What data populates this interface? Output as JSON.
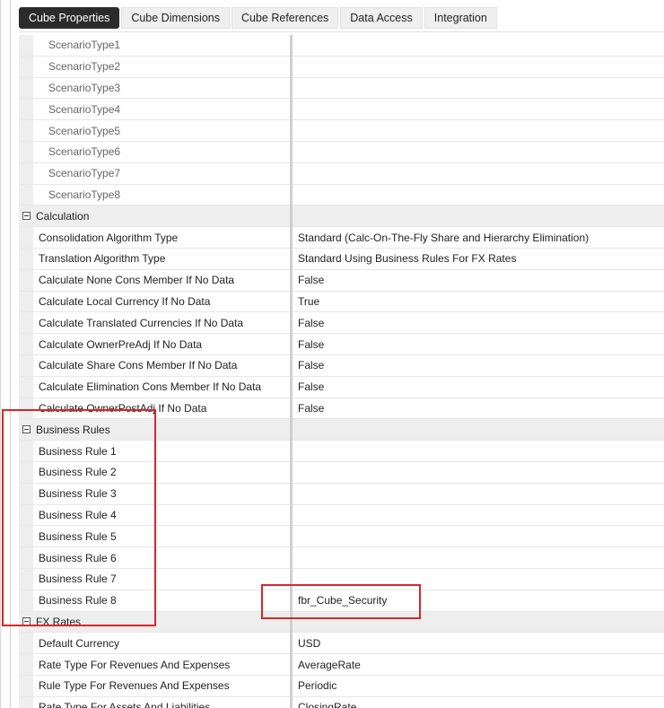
{
  "tabs": [
    {
      "label": "Cube Properties",
      "active": true
    },
    {
      "label": "Cube Dimensions",
      "active": false
    },
    {
      "label": "Cube References",
      "active": false
    },
    {
      "label": "Data Access",
      "active": false
    },
    {
      "label": "Integration",
      "active": false
    }
  ],
  "rows": [
    {
      "type": "item",
      "sub": true,
      "name": "ScenarioType1",
      "value": ""
    },
    {
      "type": "item",
      "sub": true,
      "name": "ScenarioType2",
      "value": ""
    },
    {
      "type": "item",
      "sub": true,
      "name": "ScenarioType3",
      "value": ""
    },
    {
      "type": "item",
      "sub": true,
      "name": "ScenarioType4",
      "value": ""
    },
    {
      "type": "item",
      "sub": true,
      "name": "ScenarioType5",
      "value": ""
    },
    {
      "type": "item",
      "sub": true,
      "name": "ScenarioType6",
      "value": ""
    },
    {
      "type": "item",
      "sub": true,
      "name": "ScenarioType7",
      "value": ""
    },
    {
      "type": "item",
      "sub": true,
      "name": "ScenarioType8",
      "value": ""
    },
    {
      "type": "category",
      "name": "Calculation"
    },
    {
      "type": "item",
      "name": "Consolidation Algorithm Type",
      "value": "Standard (Calc-On-The-Fly Share and Hierarchy Elimination)"
    },
    {
      "type": "item",
      "name": "Translation Algorithm Type",
      "value": "Standard Using Business Rules For FX Rates"
    },
    {
      "type": "item",
      "name": "Calculate None Cons Member If No Data",
      "value": "False"
    },
    {
      "type": "item",
      "name": "Calculate Local Currency If No Data",
      "value": "True"
    },
    {
      "type": "item",
      "name": "Calculate Translated Currencies If No Data",
      "value": "False"
    },
    {
      "type": "item",
      "name": "Calculate OwnerPreAdj If No Data",
      "value": "False"
    },
    {
      "type": "item",
      "name": "Calculate Share Cons Member If No Data",
      "value": "False"
    },
    {
      "type": "item",
      "name": "Calculate Elimination Cons Member If No Data",
      "value": "False"
    },
    {
      "type": "item",
      "name": "Calculate OwnerPostAdj If No Data",
      "value": "False"
    },
    {
      "type": "category",
      "name": "Business Rules"
    },
    {
      "type": "item",
      "name": "Business Rule 1",
      "value": ""
    },
    {
      "type": "item",
      "name": "Business Rule 2",
      "value": ""
    },
    {
      "type": "item",
      "name": "Business Rule 3",
      "value": ""
    },
    {
      "type": "item",
      "name": "Business Rule 4",
      "value": ""
    },
    {
      "type": "item",
      "name": "Business Rule 5",
      "value": ""
    },
    {
      "type": "item",
      "name": "Business Rule 6",
      "value": ""
    },
    {
      "type": "item",
      "name": "Business Rule 7",
      "value": ""
    },
    {
      "type": "item",
      "name": "Business Rule 8",
      "value": "fbr_Cube_Security"
    },
    {
      "type": "category",
      "name": "FX Rates"
    },
    {
      "type": "item",
      "name": "Default Currency",
      "value": "USD"
    },
    {
      "type": "item",
      "name": "Rate Type For Revenues And Expenses",
      "value": "AverageRate"
    },
    {
      "type": "item",
      "name": "Rule Type For Revenues And Expenses",
      "value": "Periodic"
    },
    {
      "type": "item",
      "name": "Rate Type For Assets And Liabilities",
      "value": "ClosingRate"
    }
  ],
  "highlight_color": "#d9262b"
}
